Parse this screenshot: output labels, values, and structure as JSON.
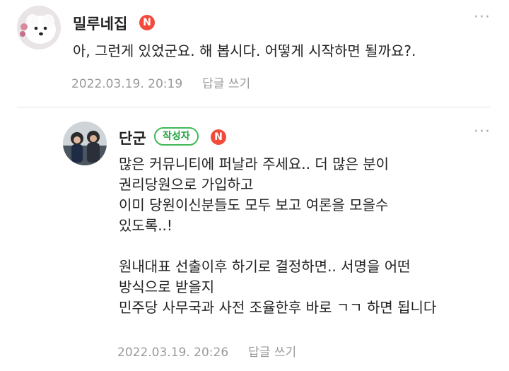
{
  "comments": [
    {
      "author": "밀루네집",
      "badge": "N",
      "text": "아, 그런게 있었군요. 해 봅시다. 어떻게 시작하면 될까요?.",
      "timestamp": "2022.03.19. 20:19",
      "reply_label": "답글 쓰기",
      "more_icon": "···"
    },
    {
      "author": "단군",
      "author_tag": "작성자",
      "badge": "N",
      "text": "많은 커뮤니티에 퍼날라 주세요.. 더 많은 분이\n권리당원으로 가입하고\n이미 당원이신분들도 모두 보고 여론을 모을수\n있도록..!\n\n원내대표 선출이후 하기로 결정하면.. 서명을 어떤\n방식으로 받을지\n민주당 사무국과 사전 조율한후 바로 ㄱㄱ 하면 됩니다",
      "timestamp": "2022.03.19. 20:26",
      "reply_label": "답글 쓰기",
      "more_icon": "···"
    }
  ],
  "colors": {
    "badge": "#f24a3b",
    "author_tag": "#3fba55",
    "meta": "#9a9a9a"
  }
}
